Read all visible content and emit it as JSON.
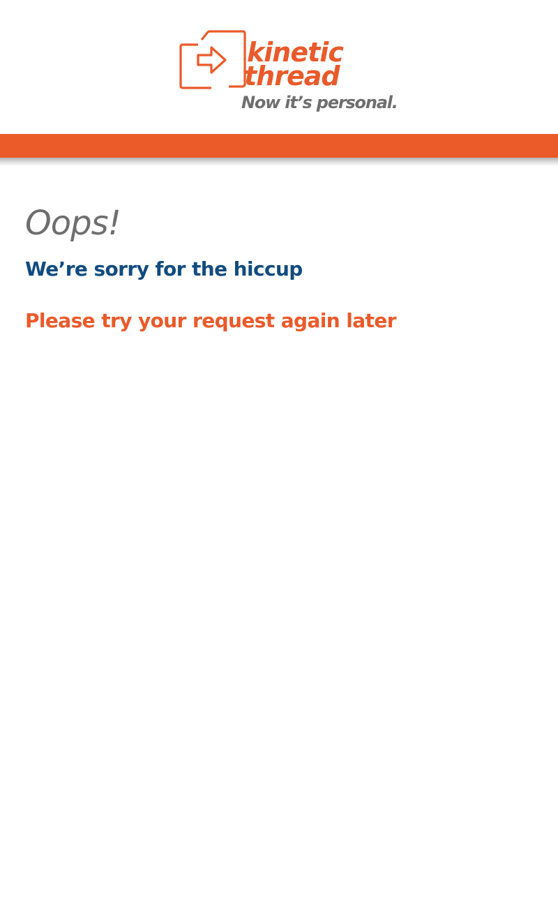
{
  "brand": {
    "name_line1": "kinetic",
    "name_line2": "thread",
    "tagline": "Now it’s personal.",
    "logo_icon": "arrow-into-box-icon",
    "primary_color": "#eb5a29",
    "tagline_color": "#6e6e6e"
  },
  "error": {
    "title": "Oops!",
    "subtitle": "We’re sorry for the hiccup",
    "message": "Please try your request again later",
    "subtitle_color": "#124b80",
    "message_color": "#ea5a2a"
  }
}
